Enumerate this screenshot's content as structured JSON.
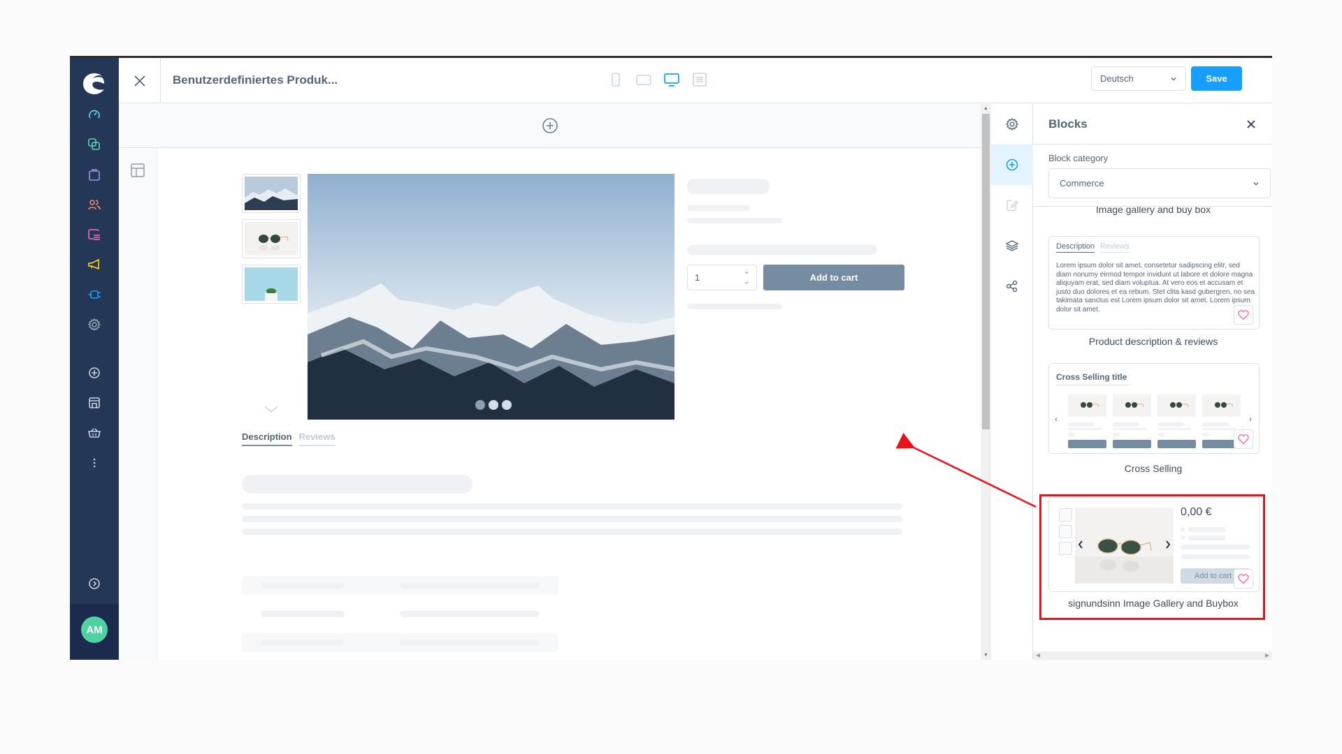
{
  "window": {
    "title": "Benutzerdefiniertes Produk..."
  },
  "admin_sidebar": {
    "logo": "shopware-logo",
    "items": [
      {
        "name": "dashboard",
        "icon": "gauge-icon",
        "color": "#57d9ef"
      },
      {
        "name": "catalogues",
        "icon": "copy-icon",
        "color": "#57d9a3"
      },
      {
        "name": "orders",
        "icon": "shopping-bag-icon",
        "color": "#a092f0"
      },
      {
        "name": "customers",
        "icon": "users-icon",
        "color": "#f88962"
      },
      {
        "name": "content",
        "icon": "content-icon",
        "color": "#ff68b4"
      },
      {
        "name": "marketing",
        "icon": "megaphone-icon",
        "color": "#ffd700"
      },
      {
        "name": "extensions",
        "icon": "plug-icon",
        "color": "#189eff"
      },
      {
        "name": "settings",
        "icon": "gear-icon",
        "color": "#9aa8b5"
      }
    ],
    "sales_channels": [
      {
        "name": "add-sales-channel",
        "icon": "plus-circle-icon"
      },
      {
        "name": "storefront",
        "icon": "storefront-icon"
      },
      {
        "name": "headless",
        "icon": "basket-icon"
      },
      {
        "name": "more",
        "icon": "more-vertical-icon"
      }
    ],
    "collapse_icon": "chevron-right-circle-icon",
    "user_initials": "AM",
    "avatar_color": "#4fd1a1"
  },
  "topbar": {
    "close_icon": "close-icon",
    "viewport_modes": [
      {
        "name": "mobile",
        "active": false
      },
      {
        "name": "tablet",
        "active": false
      },
      {
        "name": "desktop",
        "active": true
      },
      {
        "name": "form",
        "active": false
      }
    ],
    "language": "Deutsch",
    "save_label": "Save",
    "accent_color": "#189eff"
  },
  "canvas": {
    "gallery": {
      "thumbnails": [
        "mountains",
        "sunglasses",
        "cactus"
      ],
      "main_image": "mountains",
      "dot_count": 3,
      "active_dot": 0
    },
    "buybox": {
      "quantity": "1",
      "add_to_cart_label": "Add to cart"
    },
    "description_tabs": [
      {
        "label": "Description",
        "active": true
      },
      {
        "label": "Reviews",
        "active": false
      }
    ]
  },
  "blocks_panel": {
    "title": "Blocks",
    "category_label": "Block category",
    "category_value": "Commerce",
    "blocks": [
      {
        "caption": "Image gallery and buy box"
      },
      {
        "caption": "Product description & reviews",
        "preview": {
          "tabs": [
            "Description",
            "Reviews"
          ],
          "text": "Lorem ipsum dolor sit amet, consetetur sadipscing elitr, sed diam nonumy eirmod tempor invidunt ut labore et dolore magna aliquyam erat, sed diam voluptua. At vero eos et accusam et justo duo dolores et ea rebum. Stet clita kasd gubergren, no sea takimata sanctus est Lorem ipsum dolor sit amet. Lorem ipsum dolor sit amet."
        }
      },
      {
        "caption": "Cross Selling",
        "preview": {
          "title": "Cross Selling title",
          "product_count": 4
        }
      },
      {
        "caption": "signundsinn Image Gallery and Buybox",
        "highlighted": true,
        "preview": {
          "price": "0,00 €",
          "add_to_cart_label": "Add to cart"
        }
      }
    ]
  },
  "annotation": {
    "color": "#e8131b"
  }
}
